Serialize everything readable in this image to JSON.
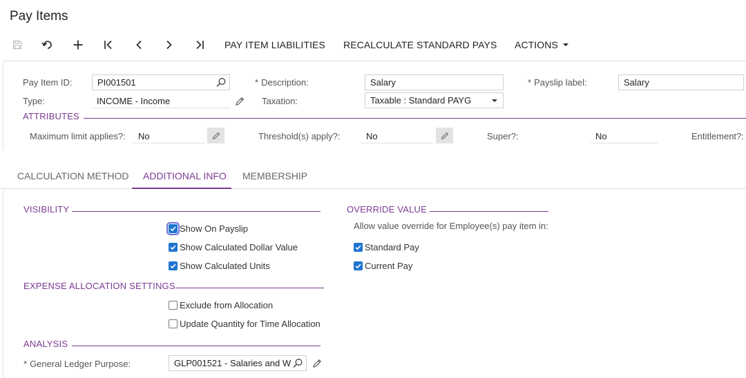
{
  "page": {
    "title": "Pay Items"
  },
  "toolbar": {
    "icons": [
      "save-icon",
      "undo-icon",
      "add-icon",
      "first-record-icon",
      "previous-record-icon",
      "next-record-icon",
      "last-record-icon"
    ],
    "liabilities_label": "PAY ITEM LIABILITIES",
    "recalculate_label": "RECALCULATE STANDARD PAYS",
    "actions_label": "ACTIONS"
  },
  "form": {
    "pay_item_id": {
      "label": "Pay Item ID:",
      "value": "PI001501"
    },
    "type": {
      "label": "Type:",
      "value": "INCOME - Income"
    },
    "description": {
      "label": "Description:",
      "value": "Salary",
      "required_mark": "*"
    },
    "taxation": {
      "label": "Taxation:",
      "value": "Taxable : Standard PAYG"
    },
    "payslip_label": {
      "label": "Payslip label:",
      "value": "Salary",
      "required_mark": "*"
    }
  },
  "attributes": {
    "title": "ATTRIBUTES",
    "maximum_limit": {
      "label": "Maximum limit applies?:",
      "value": "No"
    },
    "threshold": {
      "label": "Threshold(s) apply?:",
      "value": "No"
    },
    "super": {
      "label": "Super?:",
      "value": "No"
    },
    "entitlement": {
      "label": "Entitlement?:"
    }
  },
  "tabs": [
    {
      "label": "CALCULATION METHOD",
      "active": false
    },
    {
      "label": "ADDITIONAL INFO",
      "active": true
    },
    {
      "label": "MEMBERSHIP",
      "active": false
    }
  ],
  "visibility": {
    "title": "VISIBILITY",
    "items": [
      {
        "label": "Show On Payslip",
        "checked": true
      },
      {
        "label": "Show Calculated Dollar Value",
        "checked": true
      },
      {
        "label": "Show Calculated Units",
        "checked": true
      }
    ]
  },
  "expense_allocation": {
    "title": "EXPENSE ALLOCATION SETTINGS",
    "items": [
      {
        "label": "Exclude from Allocation",
        "checked": false
      },
      {
        "label": "Update Quantity for Time Allocation",
        "checked": false
      }
    ]
  },
  "analysis": {
    "title": "ANALYSIS",
    "gl_purpose": {
      "label": "General Ledger Purpose:",
      "value": "GLP001521 - Salaries and W",
      "required_mark": "*"
    }
  },
  "override_value": {
    "title": "OVERRIDE VALUE",
    "note": "Allow value override for Employee(s) pay item in:",
    "items": [
      {
        "label": "Standard Pay",
        "checked": true
      },
      {
        "label": "Current Pay",
        "checked": true
      }
    ]
  },
  "colors": {
    "accent": "#7a3a93",
    "checkbox": "#1f74d0"
  }
}
